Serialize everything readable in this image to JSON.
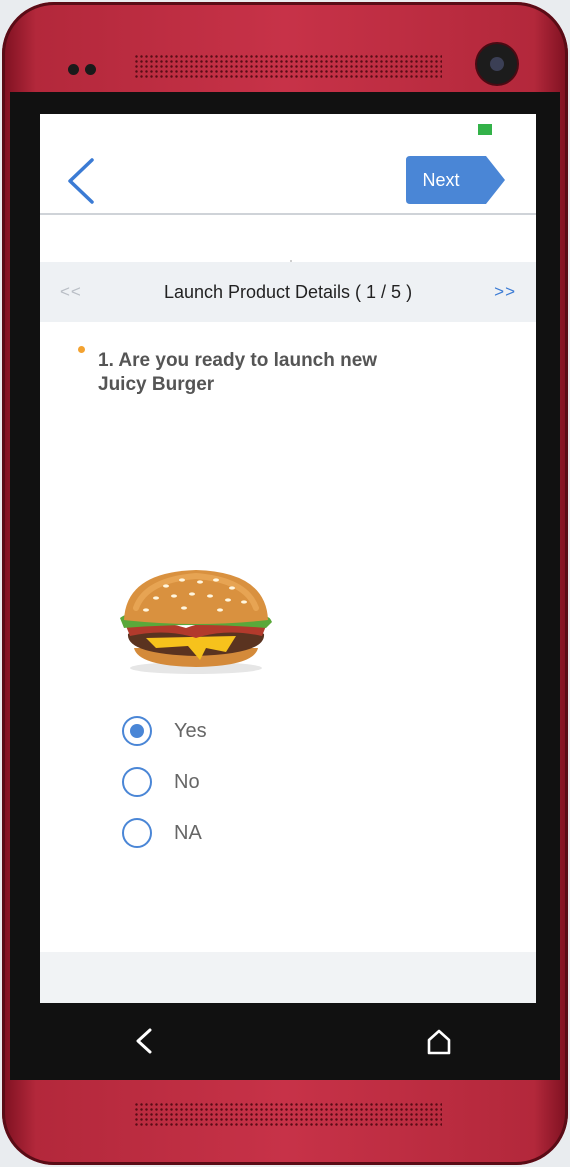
{
  "header": {
    "next_label": "Next",
    "back_icon": "chevron-left-icon"
  },
  "section_nav": {
    "prev_label": "<<",
    "title": "Launch Product Details ( 1 / 5 )",
    "next_label": ">>"
  },
  "question": {
    "text": "1. Are you ready to launch new Juicy Burger",
    "image": "burger-image"
  },
  "options": [
    {
      "label": "Yes",
      "selected": true
    },
    {
      "label": "No",
      "selected": false
    },
    {
      "label": "NA",
      "selected": false
    }
  ],
  "colors": {
    "accent": "#4a86d6",
    "bullet": "#f3a230",
    "status": "#33b249",
    "phone_body": "#c73248"
  }
}
